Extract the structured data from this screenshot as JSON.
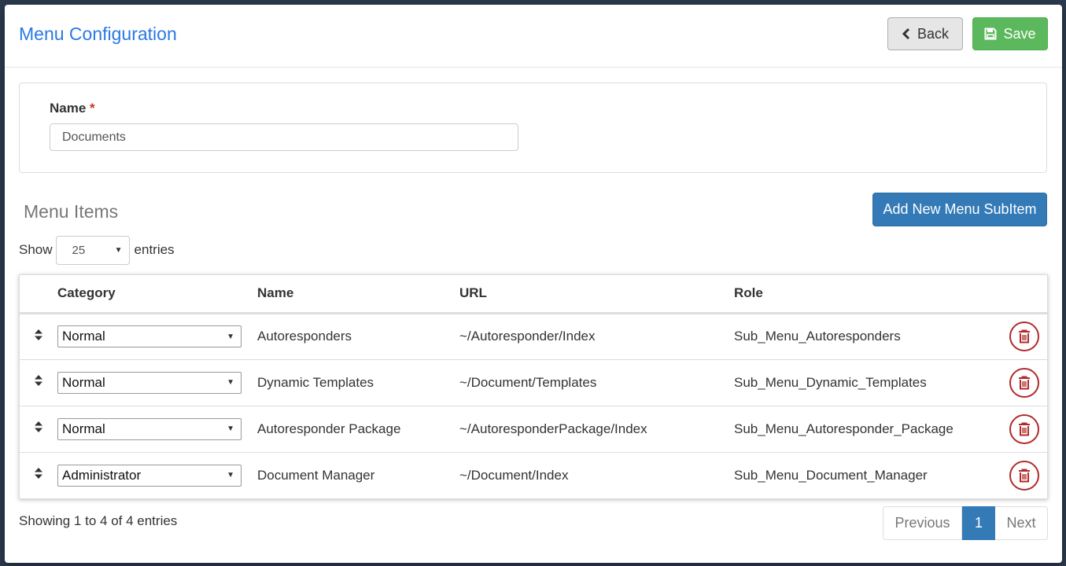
{
  "modal": {
    "title": "Menu Configuration",
    "back_label": "Back",
    "save_label": "Save"
  },
  "name_field": {
    "label": "Name",
    "required_mark": "*",
    "value": "Documents"
  },
  "menu_items": {
    "title": "Menu Items",
    "add_button_label": "Add New Menu SubItem",
    "show_label": "Show",
    "entries_label": "entries",
    "page_length": "25",
    "columns": [
      "Category",
      "Name",
      "URL",
      "Role"
    ],
    "rows": [
      {
        "category": "Normal",
        "name": "Autoresponders",
        "url": "~/Autoresponder/Index",
        "role": "Sub_Menu_Autoresponders"
      },
      {
        "category": "Normal",
        "name": "Dynamic Templates",
        "url": "~/Document/Templates",
        "role": "Sub_Menu_Dynamic_Templates"
      },
      {
        "category": "Normal",
        "name": "Autoresponder Package",
        "url": "~/AutoresponderPackage/Index",
        "role": "Sub_Menu_Autoresponder_Package"
      },
      {
        "category": "Administrator",
        "name": "Document Manager",
        "url": "~/Document/Index",
        "role": "Sub_Menu_Document_Manager"
      }
    ],
    "info": "Showing 1 to 4 of 4 entries",
    "pagination": {
      "previous": "Previous",
      "current": "1",
      "next": "Next"
    }
  },
  "colors": {
    "title": "#2a7ae2",
    "save": "#5cb85c",
    "primary": "#337ab7",
    "danger": "#b22a2a"
  },
  "icons": [
    "chevron-left-icon",
    "floppy-disk-icon",
    "sort-arrows-icon",
    "trash-icon",
    "caret-down-icon"
  ]
}
